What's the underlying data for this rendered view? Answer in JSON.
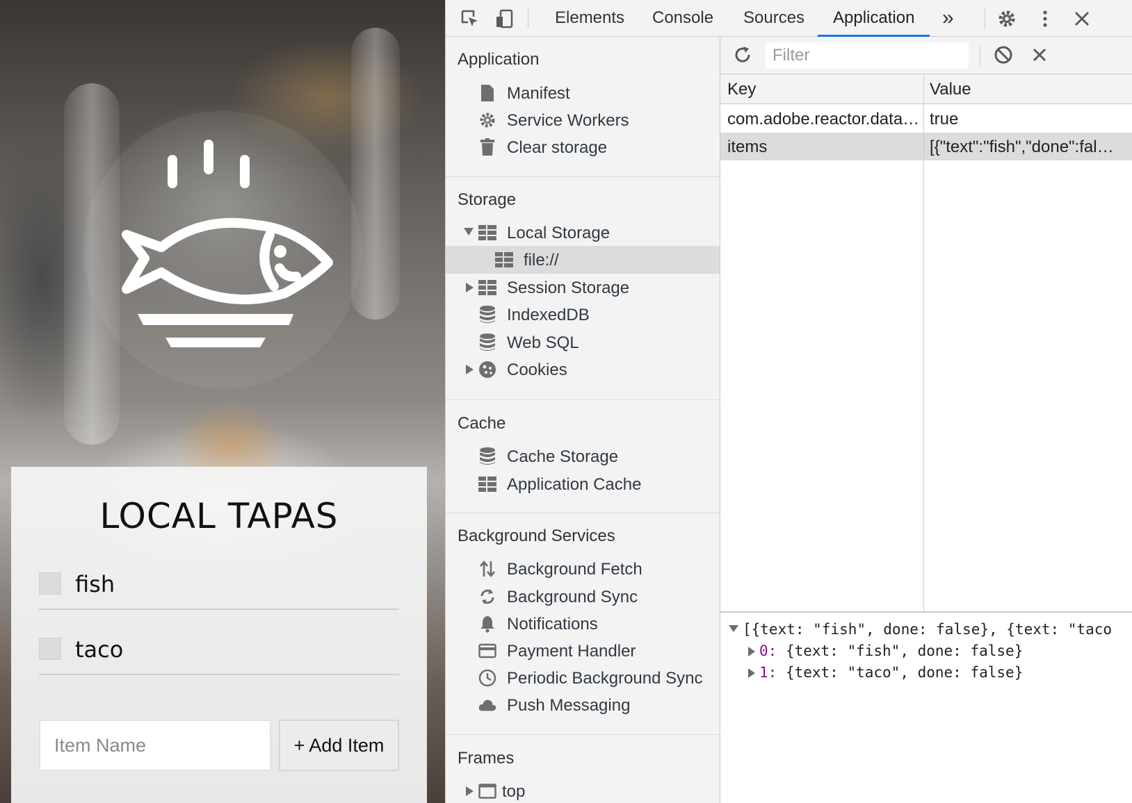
{
  "app": {
    "title": "LOCAL TAPAS",
    "items": [
      {
        "text": "fish"
      },
      {
        "text": "taco"
      }
    ],
    "input_placeholder": "Item Name",
    "add_button": "+ Add Item"
  },
  "devtools": {
    "tabs": [
      {
        "label": "Elements",
        "active": false
      },
      {
        "label": "Console",
        "active": false
      },
      {
        "label": "Sources",
        "active": false
      },
      {
        "label": "Application",
        "active": true
      }
    ],
    "more_tabs_glyph": "»",
    "sidebar": {
      "application": {
        "title": "Application",
        "items": [
          {
            "label": "Manifest",
            "icon": "file-icon"
          },
          {
            "label": "Service Workers",
            "icon": "gear-icon"
          },
          {
            "label": "Clear storage",
            "icon": "trash-icon"
          }
        ]
      },
      "storage": {
        "title": "Storage",
        "local_storage": "Local Storage",
        "local_storage_child": "file://",
        "session_storage": "Session Storage",
        "indexeddb": "IndexedDB",
        "websql": "Web SQL",
        "cookies": "Cookies"
      },
      "cache": {
        "title": "Cache",
        "cache_storage": "Cache Storage",
        "application_cache": "Application Cache"
      },
      "background": {
        "title": "Background Services",
        "items": [
          {
            "label": "Background Fetch",
            "icon": "updown-arrows-icon"
          },
          {
            "label": "Background Sync",
            "icon": "sync-icon"
          },
          {
            "label": "Notifications",
            "icon": "bell-icon"
          },
          {
            "label": "Payment Handler",
            "icon": "card-icon"
          },
          {
            "label": "Periodic Background Sync",
            "icon": "clock-icon"
          },
          {
            "label": "Push Messaging",
            "icon": "cloud-icon"
          }
        ]
      },
      "frames": {
        "title": "Frames",
        "top": "top"
      }
    },
    "storage_view": {
      "filter_placeholder": "Filter",
      "columns": {
        "key": "Key",
        "value": "Value"
      },
      "rows": [
        {
          "key": "com.adobe.reactor.data…",
          "value": "true",
          "selected": false
        },
        {
          "key": "items",
          "value": "[{\"text\":\"fish\",\"done\":fal…",
          "selected": true
        }
      ],
      "preview": {
        "summary": "[{text: \"fish\", done: false}, {text: \"taco",
        "entries": [
          {
            "index": "0",
            "value": "{text: \"fish\", done: false}"
          },
          {
            "index": "1",
            "value": "{text: \"taco\", done: false}"
          }
        ]
      }
    }
  }
}
